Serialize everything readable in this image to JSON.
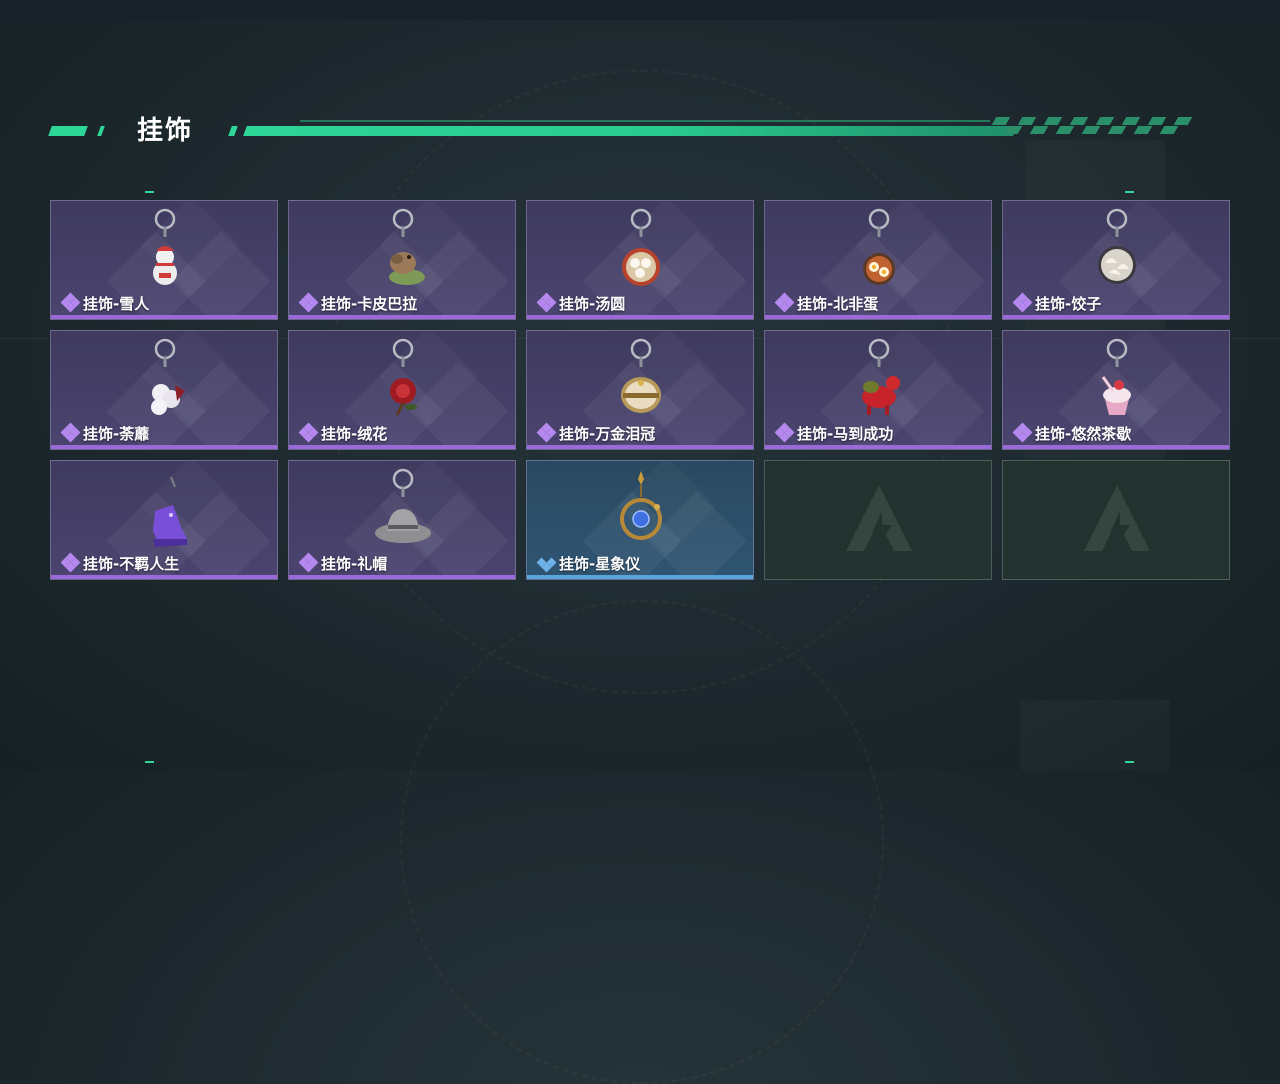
{
  "section": {
    "title": "挂饰"
  },
  "colors": {
    "accent": "#2ed698",
    "epic": "#9a6bd8",
    "rare": "#5aa4dc"
  },
  "items": [
    {
      "label": "挂饰-雪人",
      "rarity": "epic",
      "icon": "snowman-charm-icon"
    },
    {
      "label": "挂饰-卡皮巴拉",
      "rarity": "epic",
      "icon": "capybara-charm-icon"
    },
    {
      "label": "挂饰-汤圆",
      "rarity": "epic",
      "icon": "tangyuan-bowl-charm-icon"
    },
    {
      "label": "挂饰-北非蛋",
      "rarity": "epic",
      "icon": "shakshuka-pan-charm-icon"
    },
    {
      "label": "挂饰-饺子",
      "rarity": "epic",
      "icon": "dumpling-plate-charm-icon"
    },
    {
      "label": "挂饰-荼蘼",
      "rarity": "epic",
      "icon": "white-flower-charm-icon"
    },
    {
      "label": "挂饰-绒花",
      "rarity": "epic",
      "icon": "red-velvet-flower-charm-icon"
    },
    {
      "label": "挂饰-万金泪冠",
      "rarity": "epic",
      "icon": "golden-crown-charm-icon"
    },
    {
      "label": "挂饰-马到成功",
      "rarity": "epic",
      "icon": "red-horse-charm-icon"
    },
    {
      "label": "挂饰-悠然茶歇",
      "rarity": "epic",
      "icon": "cupcake-charm-icon"
    },
    {
      "label": "挂饰-不羁人生",
      "rarity": "epic",
      "icon": "purple-sneaker-charm-icon"
    },
    {
      "label": "挂饰-礼帽",
      "rarity": "epic",
      "icon": "fedora-hat-charm-icon"
    },
    {
      "label": "挂饰-星象仪",
      "rarity": "rare",
      "icon": "astrolabe-charm-icon"
    },
    {
      "label": "",
      "rarity": "empty",
      "icon": "logo-placeholder-icon"
    },
    {
      "label": "",
      "rarity": "empty",
      "icon": "logo-placeholder-icon"
    }
  ]
}
